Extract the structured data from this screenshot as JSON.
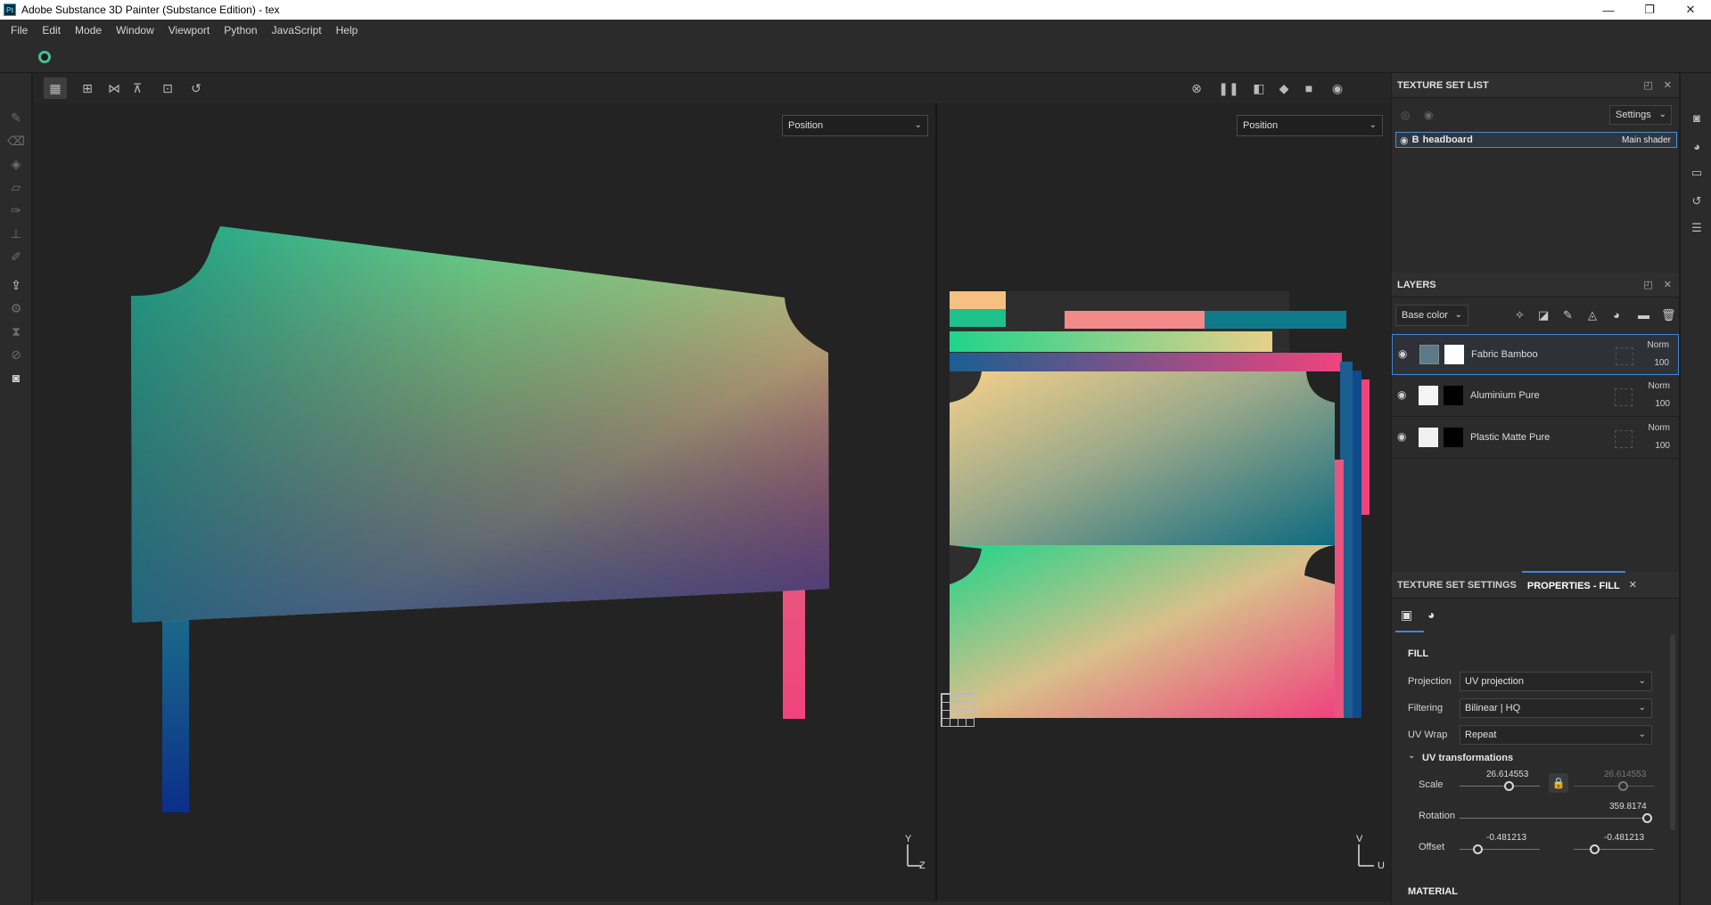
{
  "window": {
    "title": "Adobe Substance 3D Painter (Substance Edition) - tex",
    "logo": "Pt",
    "controls": [
      "—",
      "❐",
      "✕"
    ]
  },
  "menu": [
    "File",
    "Edit",
    "Mode",
    "Window",
    "Viewport",
    "Python",
    "JavaScript",
    "Help"
  ],
  "viewport": {
    "left_channel": "Position",
    "right_channel": "Position",
    "gizmo_3d": {
      "y": "Y",
      "z": "Z"
    },
    "gizmo_2d": {
      "v": "V",
      "u": "U"
    }
  },
  "texture_set_list": {
    "title": "TEXTURE SET LIST",
    "settings_label": "Settings",
    "row": {
      "prefix": "B",
      "name": "headboard",
      "shader": "Main shader"
    }
  },
  "layers": {
    "title": "LAYERS",
    "channel": "Base color",
    "items": [
      {
        "name": "Fabric Bamboo",
        "blend": "Norm",
        "opacity": "100",
        "selected": true
      },
      {
        "name": "Aluminium Pure",
        "blend": "Norm",
        "opacity": "100",
        "selected": false
      },
      {
        "name": "Plastic Matte Pure",
        "blend": "Norm",
        "opacity": "100",
        "selected": false
      }
    ]
  },
  "properties": {
    "tab_texture_set_settings": "TEXTURE SET SETTINGS",
    "tab_fill": "PROPERTIES - FILL",
    "section_fill": "FILL",
    "projection_label": "Projection",
    "projection_value": "UV projection",
    "filtering_label": "Filtering",
    "filtering_value": "Bilinear | HQ",
    "uvwrap_label": "UV Wrap",
    "uvwrap_value": "Repeat",
    "uv_transformations": "UV transformations",
    "scale_label": "Scale",
    "scale_u": "26.614553",
    "scale_v": "26.614553",
    "rotation_label": "Rotation",
    "rotation_value": "359.8174",
    "offset_label": "Offset",
    "offset_u": "-0.481213",
    "offset_v": "-0.481213",
    "section_material": "MATERIAL"
  },
  "colors": {
    "accent": "#3f87d4",
    "uv_green": "#1fd48a",
    "uv_pink": "#f0437e",
    "uv_blue": "#0f3a8a",
    "uv_yellow": "#f5d08a"
  }
}
